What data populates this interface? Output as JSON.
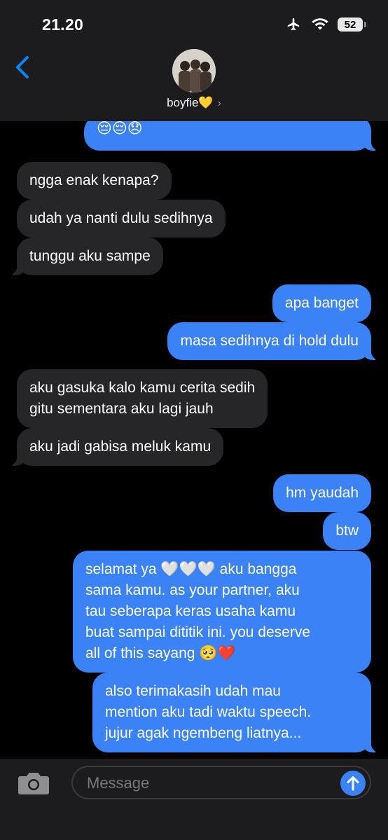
{
  "status": {
    "time": "21.20",
    "battery": "52"
  },
  "header": {
    "contact_name": "boyfie💛",
    "chevron": "›"
  },
  "messages": [
    {
      "dir": "out",
      "text": "😔😔😞"
    },
    {
      "dir": "in",
      "text": "ngga enak kenapa?"
    },
    {
      "dir": "in",
      "text": "udah ya nanti dulu sedihnya"
    },
    {
      "dir": "in",
      "text": "tunggu aku sampe"
    },
    {
      "dir": "out",
      "text": "apa banget"
    },
    {
      "dir": "out",
      "text": "masa sedihnya di hold dulu"
    },
    {
      "dir": "in",
      "text": "aku gasuka kalo kamu cerita sedih\ngitu sementara aku lagi jauh"
    },
    {
      "dir": "in",
      "text": "aku jadi gabisa meluk kamu"
    },
    {
      "dir": "out",
      "text": "hm yaudah"
    },
    {
      "dir": "out",
      "text": "btw"
    },
    {
      "dir": "out",
      "text": "selamat ya 🤍🤍🤍 aku bangga\nsama kamu. as your partner, aku\ntau seberapa keras usaha kamu\nbuat sampai dititik ini. you deserve\nall of this sayang 🥺❤️"
    },
    {
      "dir": "out",
      "text": "also terimakasih udah mau\nmention aku tadi waktu speech.\njujur agak ngembeng liatnya..."
    }
  ],
  "composer": {
    "placeholder": "Message"
  },
  "colors": {
    "outgoing": "#3b82f6",
    "incoming": "#262628",
    "background": "#000000",
    "accent": "#0a84ff"
  },
  "icons": [
    "back-chevron-icon",
    "airplane-icon",
    "wifi-icon",
    "battery-icon",
    "camera-icon",
    "send-arrow-icon"
  ]
}
